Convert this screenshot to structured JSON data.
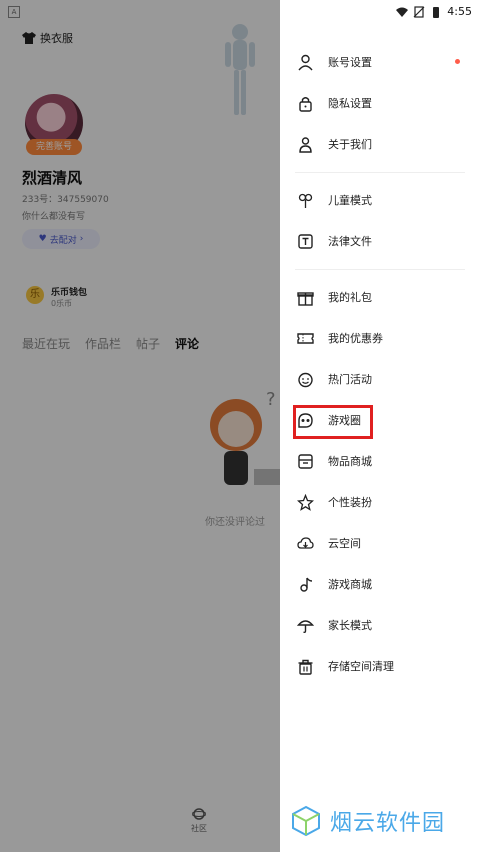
{
  "background": {
    "header_label": "换衣服",
    "profile": {
      "badge": "完善账号",
      "name": "烈酒清风",
      "id_line": "233号：347559070",
      "bio": "你什么都没有写",
      "match_button": "去配对"
    },
    "wallet": {
      "icon_text": "乐",
      "title": "乐币钱包",
      "value": "0乐币"
    },
    "tabs": [
      "最近在玩",
      "作品栏",
      "帖子",
      "评论"
    ],
    "active_tab": "评论",
    "empty_text": "你还没评论过",
    "bottom_nav": {
      "community": "社区"
    }
  },
  "status_bar": {
    "time": "4:55"
  },
  "drawer": {
    "menu_group1": [
      {
        "label": "账号设置",
        "icon": "user-icon",
        "dot": true
      },
      {
        "label": "隐私设置",
        "icon": "lock-icon"
      },
      {
        "label": "关于我们",
        "icon": "about-icon"
      }
    ],
    "menu_group2": [
      {
        "label": "儿童模式",
        "icon": "flower-icon"
      },
      {
        "label": "法律文件",
        "icon": "document-icon"
      }
    ],
    "menu_group3": [
      {
        "label": "我的礼包",
        "icon": "gift-icon"
      },
      {
        "label": "我的优惠券",
        "icon": "coupon-icon"
      },
      {
        "label": "热门活动",
        "icon": "smile-icon"
      },
      {
        "label": "游戏圈",
        "icon": "game-circle-icon",
        "highlighted": true
      },
      {
        "label": "物品商城",
        "icon": "shop-icon"
      },
      {
        "label": "个性装扮",
        "icon": "star-icon"
      },
      {
        "label": "云空间",
        "icon": "cloud-icon"
      },
      {
        "label": "游戏商城",
        "icon": "music-note-icon"
      },
      {
        "label": "家长模式",
        "icon": "umbrella-icon"
      },
      {
        "label": "存储空间清理",
        "icon": "trash-icon"
      }
    ],
    "highlight_color": "#e02020",
    "dot_color": "#ff5c4a"
  },
  "watermark": {
    "text": "烟云软件园"
  }
}
